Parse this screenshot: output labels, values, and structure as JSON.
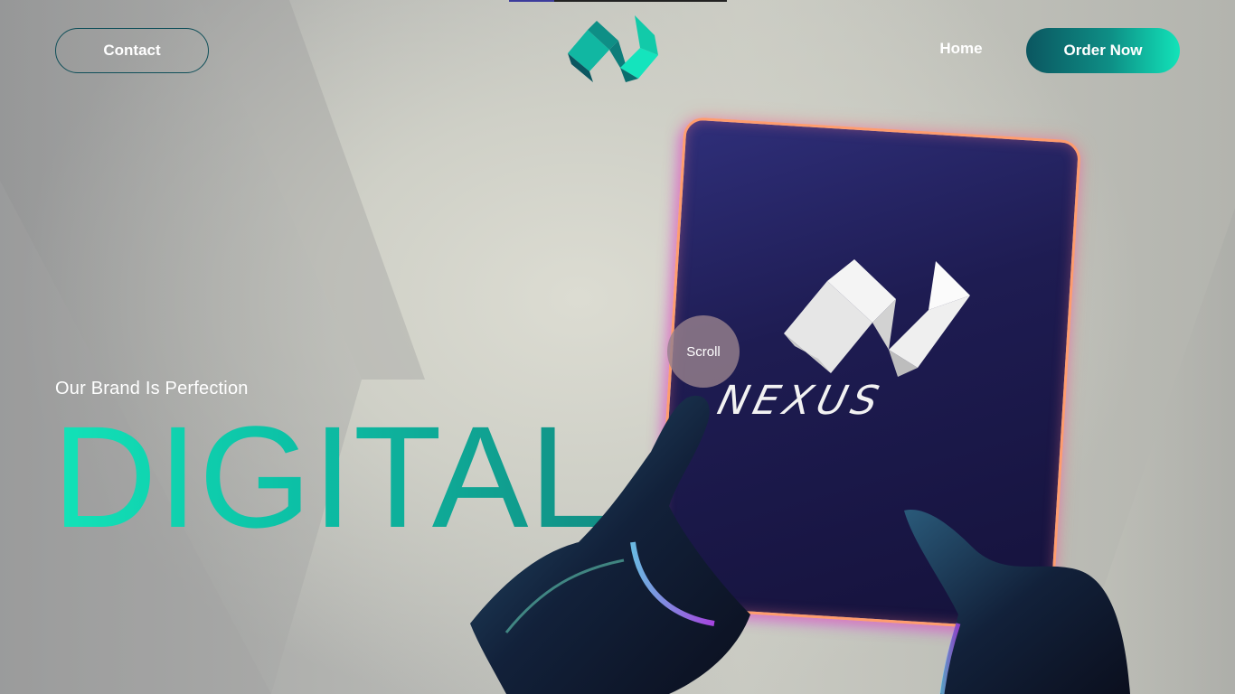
{
  "header": {
    "contact_label": "Contact",
    "home_label": "Home",
    "order_label": "Order Now",
    "logo_icon": "nexus-n-logo-icon"
  },
  "hero": {
    "tagline": "Our Brand Is Perfection",
    "title": "DIGITAL",
    "scroll_label": "Scroll"
  },
  "device": {
    "brand_word": "NEXUS",
    "logo_icon": "nexus-n-logo-icon"
  },
  "colors": {
    "accent_teal": "#12e3b9",
    "accent_dark_teal": "#0b5660",
    "tablet_screen": "#1e1c52",
    "tablet_glow": "#ff9c6e"
  }
}
